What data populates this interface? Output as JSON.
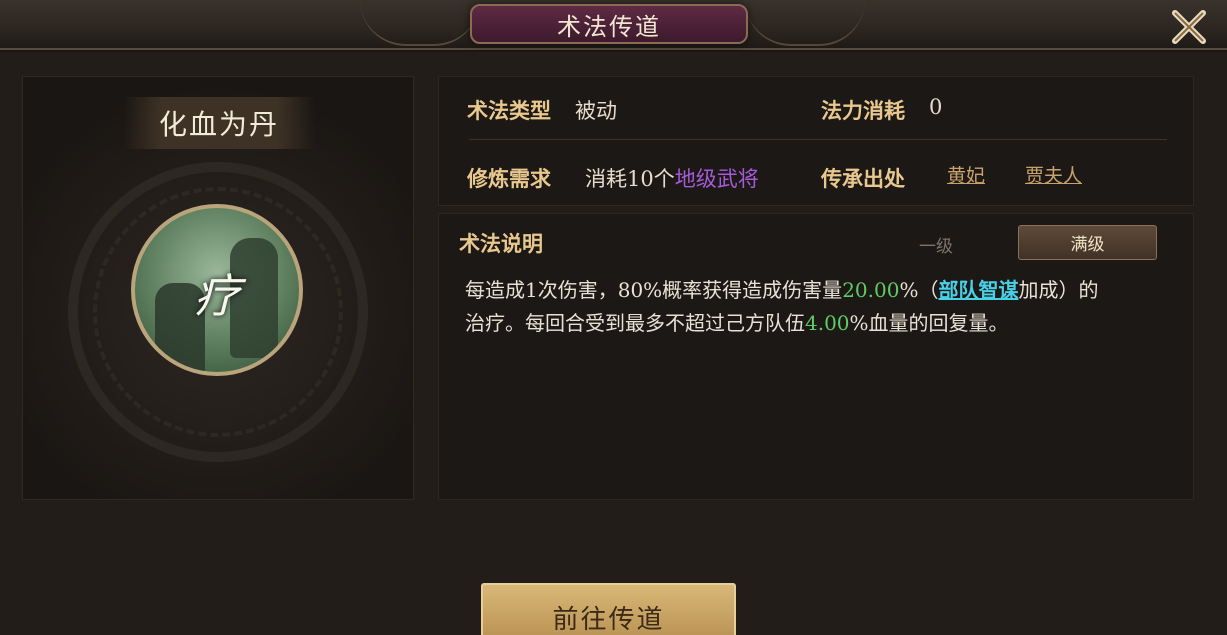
{
  "window": {
    "title": "术法传道",
    "close_icon": "close-x-icon"
  },
  "skill": {
    "name": "化血为丹",
    "emblem_char": "疗",
    "emblem_icon": "skill-emblem-healing"
  },
  "info": {
    "type_label": "术法类型",
    "type_value": "被动",
    "cost_label": "法力消耗",
    "cost_value": "0",
    "requirement_label": "修炼需求",
    "requirement_prefix": "消耗10个",
    "requirement_highlight": "地级武将",
    "source_label": "传承出处",
    "sources": [
      "黄妃",
      "贾夫人"
    ]
  },
  "description": {
    "title": "术法说明",
    "level_tabs": [
      "一级",
      "满级"
    ],
    "selected_tab": "满级",
    "line1_a": "每造成1次伤害，80%概率获得造成伤害量",
    "line1_pct": "20.00",
    "line1_b": "%（",
    "line1_link": "部队智谋",
    "line1_c": "加成）的",
    "line2_a": "治疗。每回合受到最多不超过己方队伍",
    "line2_pct": "4.00",
    "line2_b": "%血量的回复量。"
  },
  "actions": {
    "go_label": "前往传道"
  },
  "colors": {
    "label": "#e9c88f",
    "purple_rank": "#a65ad8",
    "green_value": "#5fcb63",
    "cyan_link": "#47d1e8",
    "button_gold": "#d8b878"
  }
}
